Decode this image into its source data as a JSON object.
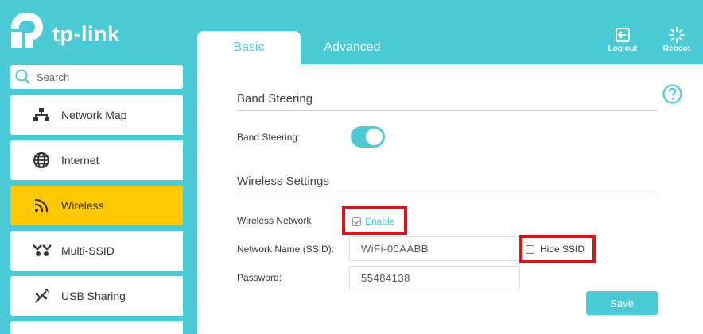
{
  "brand": {
    "name": "tp-link"
  },
  "search": {
    "placeholder": "Search"
  },
  "sidebar": {
    "items": [
      {
        "label": "Network Map",
        "icon": "network-map-icon"
      },
      {
        "label": "Internet",
        "icon": "globe-icon"
      },
      {
        "label": "Wireless",
        "icon": "wifi-icon",
        "active": true
      },
      {
        "label": "Multi-SSID",
        "icon": "multi-ssid-icon"
      },
      {
        "label": "USB Sharing",
        "icon": "usb-icon"
      }
    ]
  },
  "tabs": [
    {
      "label": "Basic",
      "selected": true
    },
    {
      "label": "Advanced",
      "selected": false
    }
  ],
  "header_actions": {
    "logout_label": "Log out",
    "reboot_label": "Reboot"
  },
  "band_steering": {
    "section_title": "Band Steering",
    "field_label": "Band Steering:",
    "enabled": true
  },
  "wireless_settings": {
    "section_title": "Wireless Settings",
    "wireless_network_label": "Wireless Network",
    "enable_label": "Enable",
    "enable_checked": true,
    "ssid_label": "Network Name (SSID):",
    "ssid_value": "WiFi-00AABB",
    "hide_ssid_label": "Hide SSID",
    "hide_ssid_checked": false,
    "password_label": "Password:",
    "password_value": "55484138"
  },
  "save_label": "Save",
  "colors": {
    "accent": "#4acbd6",
    "active_nav": "#ffc800",
    "highlight_box": "#e0101c"
  }
}
